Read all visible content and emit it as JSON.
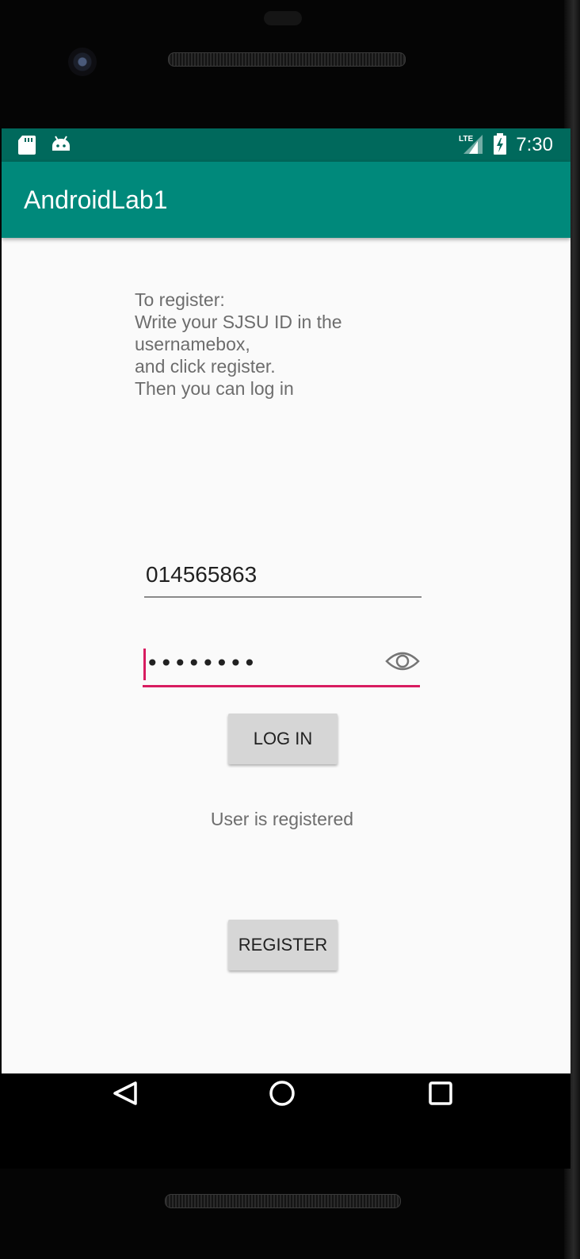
{
  "status_bar": {
    "time": "7:30",
    "network": "LTE",
    "icons": [
      "sd-card-icon",
      "android-icon",
      "lte-signal-icon",
      "battery-charging-icon"
    ],
    "color": "#00695c"
  },
  "app_bar": {
    "title": "AndroidLab1",
    "color": "#00897b"
  },
  "instructions": {
    "lines": [
      "To register:",
      "Write your SJSU ID in the",
      "usernamebox,",
      "and click register.",
      "Then you can log in"
    ]
  },
  "form": {
    "username_value": "014565863",
    "password_value": "••••••••",
    "accent_color": "#d81b60",
    "login_label": "LOG IN",
    "status_message": "User is registered",
    "register_label": "REGISTER"
  },
  "nav_bar": {
    "buttons": [
      "back-icon",
      "home-icon",
      "recents-icon"
    ]
  }
}
